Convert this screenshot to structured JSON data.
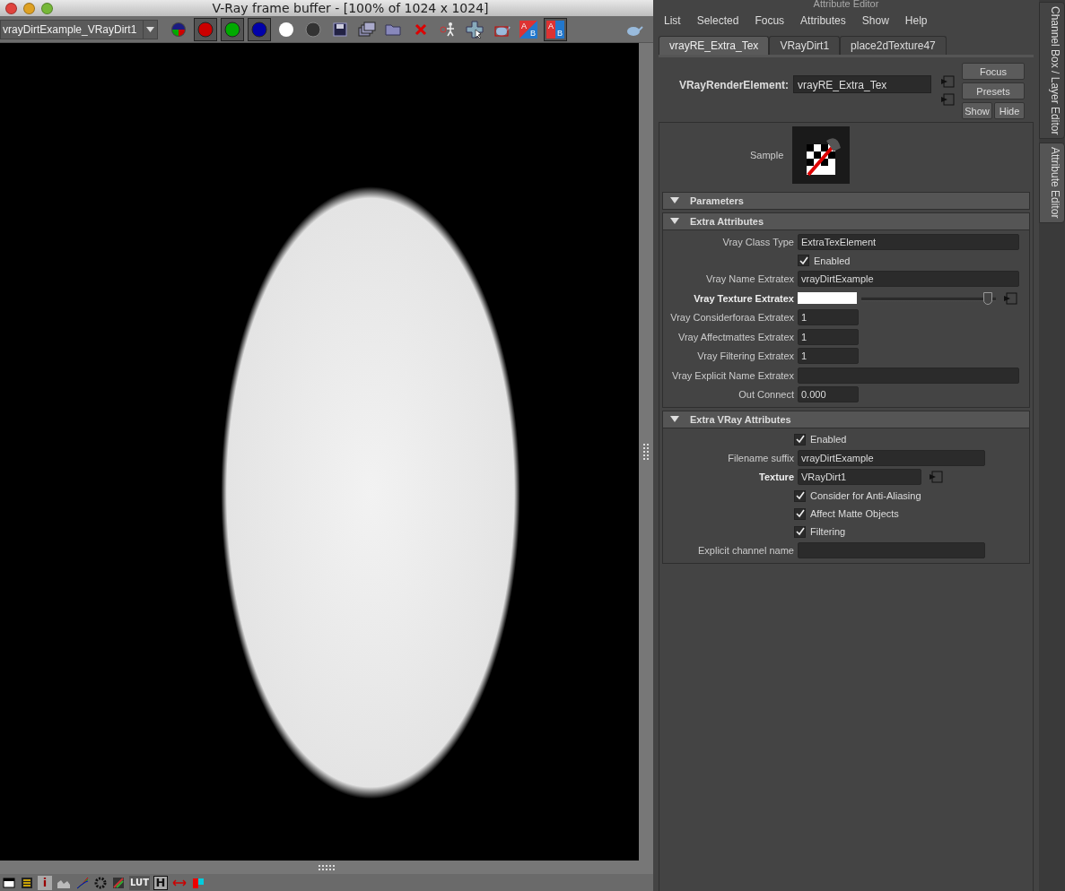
{
  "frame_buffer": {
    "title": "V-Ray frame buffer - [100% of 1024 x 1024]",
    "channel_select": "vrayDirtExample_VRayDirt1",
    "toolbar": [
      {
        "kind": "rgb"
      },
      {
        "kind": "channel",
        "color": "#cc0000",
        "selected": true
      },
      {
        "kind": "channel",
        "color": "#00aa00",
        "selected": true
      },
      {
        "kind": "channel",
        "color": "#0000aa",
        "selected": true
      },
      {
        "kind": "white"
      },
      {
        "kind": "mono"
      },
      {
        "kind": "save"
      },
      {
        "kind": "copy"
      },
      {
        "kind": "open"
      },
      {
        "kind": "clear"
      },
      {
        "kind": "track"
      },
      {
        "kind": "region"
      },
      {
        "kind": "teapot"
      },
      {
        "kind": "ab",
        "label_a": "A",
        "label_b": "B",
        "selected": false
      },
      {
        "kind": "ab",
        "label_a": "A",
        "label_b": "B",
        "selected": true
      }
    ],
    "bottom_toolbar": [
      {
        "kind": "window"
      },
      {
        "kind": "levels"
      },
      {
        "kind": "info",
        "label": "i"
      },
      {
        "kind": "histogram"
      },
      {
        "kind": "curve"
      },
      {
        "kind": "gear"
      },
      {
        "kind": "srgb"
      },
      {
        "kind": "lut",
        "label": "LUT"
      },
      {
        "kind": "boxed",
        "label": "H"
      },
      {
        "kind": "compare"
      },
      {
        "kind": "stereo"
      }
    ]
  },
  "attribute_editor": {
    "title": "Attribute Editor",
    "menu": [
      "List",
      "Selected",
      "Focus",
      "Attributes",
      "Show",
      "Help"
    ],
    "tabs": [
      {
        "label": "vrayRE_Extra_Tex",
        "selected": true
      },
      {
        "label": "VRayDirt1",
        "selected": false
      },
      {
        "label": "place2dTexture47",
        "selected": false
      }
    ],
    "node_label": "VRayRenderElement:",
    "node_value": "vrayRE_Extra_Tex",
    "buttons": [
      "Focus",
      "Presets",
      "Show",
      "Hide"
    ],
    "sample_label": "Sample",
    "sections": [
      {
        "title": "Parameters",
        "expanded": true
      },
      {
        "title": "Extra Attributes",
        "expanded": true,
        "rows": [
          {
            "kind": "wide_field",
            "label": "Vray Class Type",
            "value": "ExtraTexElement",
            "bold": false
          },
          {
            "kind": "checkbox",
            "label": "Enabled",
            "checked": true
          },
          {
            "kind": "wide_field",
            "label": "Vray Name Extratex",
            "value": "vrayDirtExample",
            "bold": false
          },
          {
            "kind": "color",
            "label": "Vray Texture Extratex",
            "color": "#ffffff",
            "level": 0.97,
            "bold": true
          },
          {
            "kind": "short_field",
            "label": "Vray Considerforaa Extratex",
            "value": "1",
            "bold": false
          },
          {
            "kind": "short_field",
            "label": "Vray Affectmattes Extratex",
            "value": "1",
            "bold": false
          },
          {
            "kind": "short_field",
            "label": "Vray Filtering Extratex",
            "value": "1",
            "bold": false
          },
          {
            "kind": "wide_field",
            "label": "Vray Explicit Name Extratex",
            "bold": false
          },
          {
            "kind": "short_field",
            "label": "Out Connect",
            "value": "0.000",
            "bold": false
          }
        ]
      },
      {
        "title": "Extra VRay Attributes",
        "expanded": true,
        "rows": [
          {
            "kind": "checkbox",
            "label": "Enabled",
            "checked": true
          },
          {
            "kind": "wide_field",
            "label": "Filename suffix",
            "value": "vrayDirtExample",
            "bold": false
          },
          {
            "kind": "texture",
            "label": "Texture",
            "value": "VRayDirt1",
            "bold": true
          },
          {
            "kind": "checkbox",
            "label": "Consider for Anti-Aliasing",
            "checked": true
          },
          {
            "kind": "checkbox",
            "label": "Affect Matte Objects",
            "checked": true
          },
          {
            "kind": "checkbox",
            "label": "Filtering",
            "checked": true
          },
          {
            "kind": "wide_field",
            "label": "Explicit channel name",
            "bold": false
          }
        ]
      }
    ]
  },
  "side_tabs": [
    {
      "label": "Channel Box / Layer Editor",
      "selected": false
    },
    {
      "label": "Attribute Editor",
      "selected": true
    }
  ]
}
